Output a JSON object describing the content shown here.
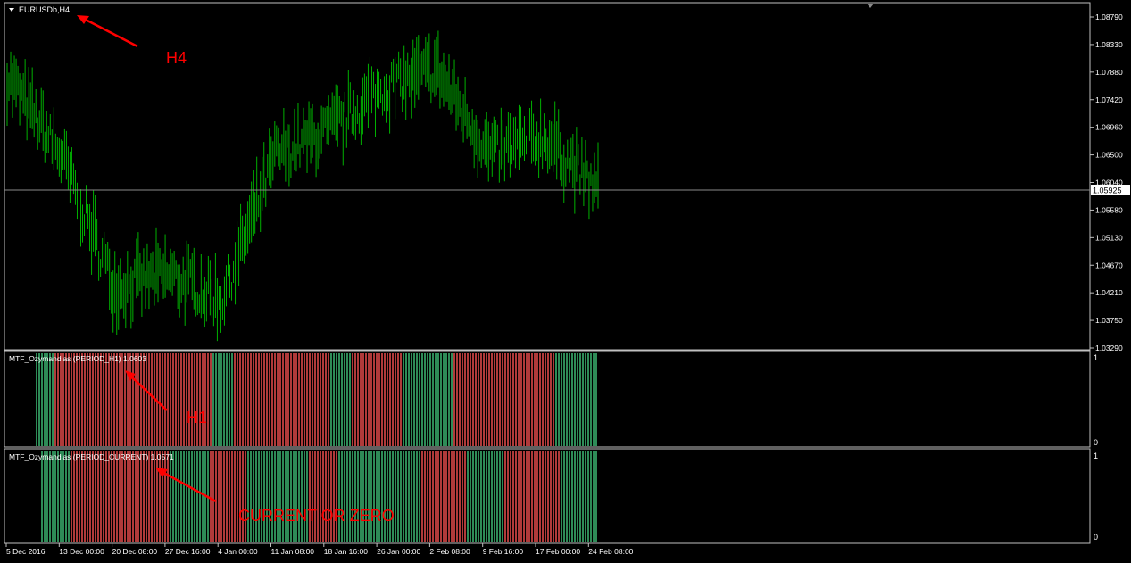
{
  "colors": {
    "background": "#000000",
    "frame": "#c0c0c0",
    "candle": "#00b000",
    "bull_bar": "#2e8b57",
    "bear_bar": "#b03a3a",
    "text": "#ffffff",
    "annotation": "#ff0000",
    "current_price_line": "#808080"
  },
  "main_chart": {
    "symbol_label": "EURUSDb,H4",
    "annotation": "H4",
    "current_price_label": "1.05925",
    "price_axis": [
      "1.08790",
      "1.08330",
      "1.07880",
      "1.07420",
      "1.06960",
      "1.06500",
      "1.06040",
      "1.05580",
      "1.05130",
      "1.04670",
      "1.04210",
      "1.03750",
      "1.03290"
    ],
    "price_range": [
      1.0329,
      1.0879
    ],
    "current_price": 1.05925
  },
  "indicator_h1": {
    "label": "MTF_Ozymandias (PERIOD_H1) 1.0603",
    "annotation": "H1",
    "scale_top": "1",
    "scale_bottom": "0"
  },
  "indicator_current": {
    "label": "MTF_Ozymandias (PERIOD_CURRENT) 1.0571",
    "annotation": "CURRENT OR ZERO",
    "scale_top": "1",
    "scale_bottom": "0"
  },
  "time_axis": [
    "5 Dec 2016",
    "13 Dec 00:00",
    "20 Dec 08:00",
    "27 Dec 16:00",
    "4 Jan 00:00",
    "11 Jan 08:00",
    "18 Jan 16:00",
    "26 Jan 00:00",
    "2 Feb 08:00",
    "9 Feb 16:00",
    "17 Feb 00:00",
    "24 Feb 08:00"
  ],
  "chart_data": {
    "type": "line",
    "title": "EURUSDb,H4",
    "x": [
      "5 Dec 2016",
      "13 Dec 00:00",
      "20 Dec 08:00",
      "27 Dec 16:00",
      "4 Jan 00:00",
      "11 Jan 08:00",
      "18 Jan 16:00",
      "26 Jan 00:00",
      "2 Feb 08:00",
      "9 Feb 16:00",
      "17 Feb 00:00",
      "24 Feb 08:00"
    ],
    "series": [
      {
        "values": [
          1.078,
          1.065,
          1.043,
          1.045,
          1.041,
          1.065,
          1.069,
          1.076,
          1.079,
          1.065,
          1.068,
          1.059
        ]
      }
    ],
    "ylim": [
      1.0329,
      1.0879
    ],
    "regime_h1": [
      {
        "to": 0.03,
        "state": "bull"
      },
      {
        "to": 0.31,
        "state": "bear"
      },
      {
        "to": 0.35,
        "state": "bull"
      },
      {
        "to": 0.52,
        "state": "bear"
      },
      {
        "to": 0.56,
        "state": "bull"
      },
      {
        "to": 0.65,
        "state": "bear"
      },
      {
        "to": 0.74,
        "state": "bull"
      },
      {
        "to": 0.92,
        "state": "bear"
      },
      {
        "to": 1.0,
        "state": "bull"
      }
    ],
    "regime_current": [
      {
        "to": 0.05,
        "state": "bull"
      },
      {
        "to": 0.23,
        "state": "bear"
      },
      {
        "to": 0.3,
        "state": "bull"
      },
      {
        "to": 0.37,
        "state": "bear"
      },
      {
        "to": 0.48,
        "state": "bull"
      },
      {
        "to": 0.53,
        "state": "bear"
      },
      {
        "to": 0.68,
        "state": "bull"
      },
      {
        "to": 0.76,
        "state": "bear"
      },
      {
        "to": 0.83,
        "state": "bull"
      },
      {
        "to": 0.93,
        "state": "bear"
      },
      {
        "to": 1.0,
        "state": "bull"
      }
    ]
  }
}
